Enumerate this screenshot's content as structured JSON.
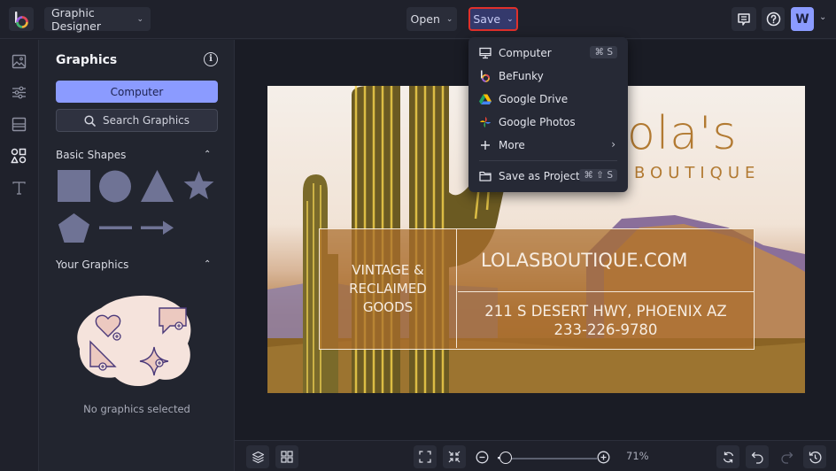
{
  "topbar": {
    "app_logo": "befunky-logo",
    "project_menu_label": "Graphic Designer",
    "open_label": "Open",
    "save_label": "Save",
    "avatar_initial": "W",
    "icons": [
      "comment-icon",
      "help-icon",
      "chevron-down-icon"
    ]
  },
  "rail": {
    "items": [
      {
        "name": "image-manager",
        "icon": "image-icon"
      },
      {
        "name": "customize",
        "icon": "sliders-icon"
      },
      {
        "name": "layouts",
        "icon": "layout-icon"
      },
      {
        "name": "graphics",
        "icon": "shapes-icon",
        "active": true
      },
      {
        "name": "text",
        "icon": "text-icon"
      }
    ]
  },
  "panel": {
    "title": "Graphics",
    "computer_button": "Computer",
    "search_button": "Search Graphics",
    "basic_shapes_label": "Basic Shapes",
    "shapes": [
      "square",
      "circle",
      "triangle",
      "star",
      "pentagon",
      "line",
      "arrow"
    ],
    "your_graphics_label": "Your Graphics",
    "empty_text": "No graphics selected"
  },
  "save_menu": {
    "items": [
      {
        "label": "Computer",
        "icon": "monitor-icon",
        "shortcut": "⌘ S"
      },
      {
        "label": "BeFunky",
        "icon": "befunky-icon"
      },
      {
        "label": "Google Drive",
        "icon": "google-drive-icon"
      },
      {
        "label": "Google Photos",
        "icon": "google-photos-icon"
      },
      {
        "label": "More",
        "icon": "plus-icon",
        "submenu": true
      },
      {
        "label": "Save as Project",
        "icon": "folder-icon",
        "shortcut": "⌘ ⇧ S"
      }
    ]
  },
  "design": {
    "brand_name": "ola's",
    "brand_sub": "BOUTIQUE",
    "tagline_lines": [
      "VINTAGE &",
      "RECLAIMED",
      "GOODS"
    ],
    "website": "LOLASBOUTIQUE.COM",
    "address": "211 S DESERT HWY, PHOENIX AZ",
    "phone": "233-226-9780",
    "colors": {
      "brand": "#b27a32",
      "card": "#aa6e2d"
    }
  },
  "bottombar": {
    "zoom_percent": "71%",
    "zoom_slider_value": 0.08
  },
  "colors": {
    "accent": "#8b9bff",
    "highlight_border": "#e0302b",
    "background": "#1f212b"
  }
}
